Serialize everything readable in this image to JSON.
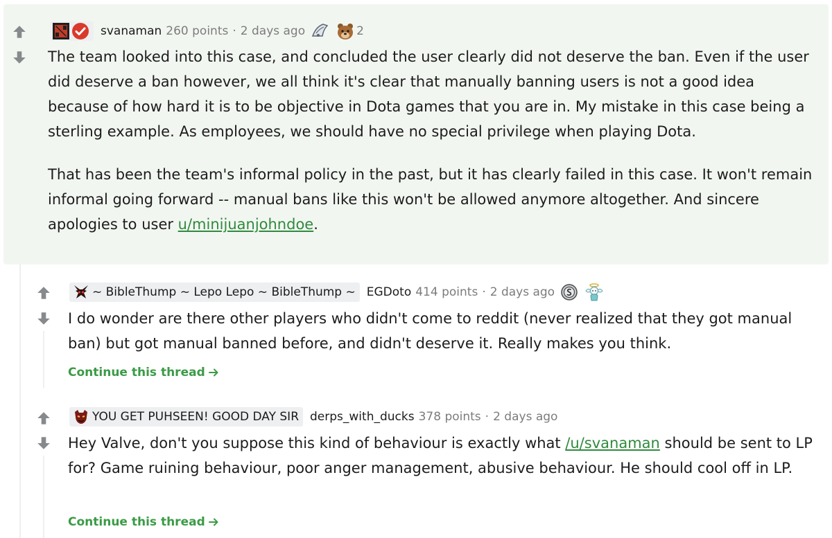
{
  "comments": [
    {
      "author": "svanaman",
      "points": "260 points",
      "dot": "·",
      "time": "2 days ago",
      "award_count": "2",
      "body_p1": "The team looked into this case, and concluded the user clearly did not deserve the ban. Even if the user did deserve a ban however, we all think it's clear that manually banning users is not a good idea because of how hard it is to be objective in Dota games that you are in. My mistake in this case being a sterling example. As employees, we should have no special privilege when playing Dota.",
      "body_p2_prefix": "That has been the team's informal policy in the past, but it has clearly failed in this case. It won't remain informal going forward -- manual bans like this won't be allowed anymore altogether. And sincere apologies to user ",
      "body_p2_link": "u/minijuanjohndoe",
      "body_p2_suffix": "."
    },
    {
      "flair": "~ BibleThump ~ Lepo Lepo ~ BibleThump ~",
      "author": "EGDoto",
      "points": "414 points",
      "dot": "·",
      "time": "2 days ago",
      "body": "I do wonder are there other players who didn't come to reddit (never realized that they got manual ban) but got manual banned before, and didn't deserve it. Really makes you think.",
      "continue": "Continue this thread"
    },
    {
      "flair": "YOU GET PUHSEEN! GOOD DAY SIR",
      "author": "derps_with_ducks",
      "points": "378 points",
      "dot": "·",
      "time": "2 days ago",
      "body_prefix": "Hey Valve, don't you suppose this kind of behaviour is exactly what ",
      "body_link": "/u/svanaman",
      "body_suffix": " should be sent to LP for? Game ruining behaviour, poor anger management, abusive behaviour. He should cool off in LP.",
      "continue": "Continue this thread"
    }
  ],
  "colors": {
    "highlight_bg": "#f2f6f1",
    "link": "#2f8a3d",
    "continue": "#3b9b46",
    "meta_grey": "#7c7c7c",
    "vote_grey": "#878a8c"
  },
  "icons": {
    "upvote": "upvote-arrow-icon",
    "downvote": "downvote-arrow-icon",
    "arrow_right": "arrow-right-icon"
  }
}
